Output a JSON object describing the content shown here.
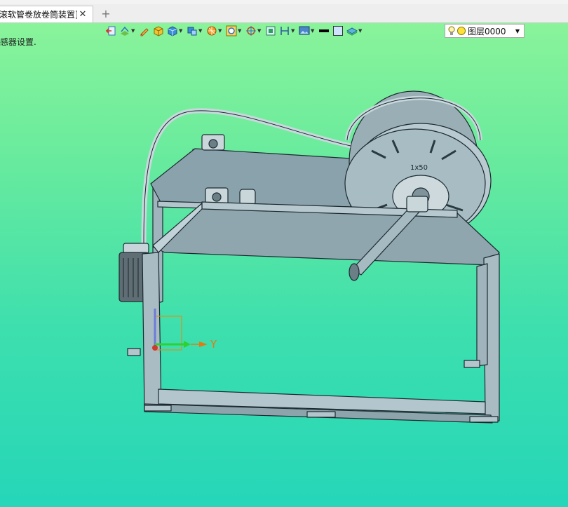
{
  "tabs": [
    {
      "title": "滚软管卷放卷筒装置]"
    }
  ],
  "tab_close_glyph": "✕",
  "new_tab_glyph": "+",
  "status_hint": "感器设置.",
  "toolbar": {
    "icons": [
      "exit-sketch-icon",
      "sketch-plane-icon",
      "edit-icon",
      "solid-box-icon",
      "view-cube-icon",
      "display-mode-icon",
      "render-style-icon",
      "zoom-fit-icon",
      "center-target-icon",
      "select-frame-icon",
      "dimension-icon",
      "image-view-icon",
      "line-color-icon",
      "fill-color-icon",
      "layer-stack-icon"
    ]
  },
  "layer": {
    "value": "图层0000",
    "bulb_color": "#ffe13a"
  },
  "model": {
    "drum_label": "1x50"
  },
  "triad": {
    "axis_y_label": "Y"
  }
}
